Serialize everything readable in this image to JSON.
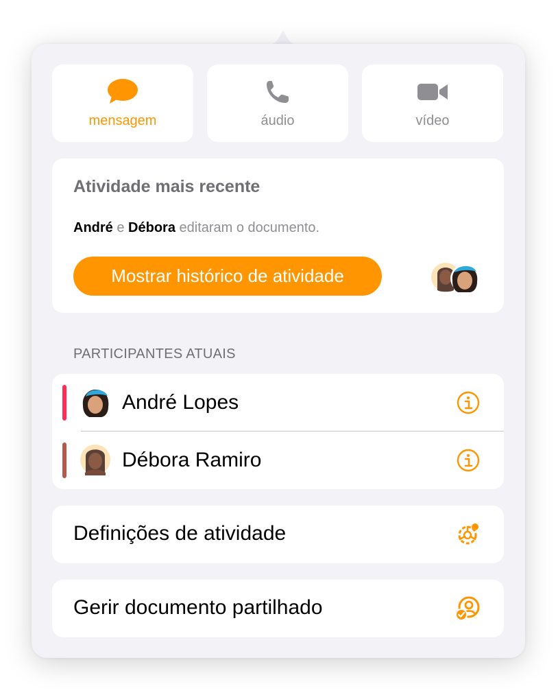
{
  "contact_buttons": [
    {
      "label": "mensagem",
      "icon": "message-bubble-icon",
      "active": true
    },
    {
      "label": "áudio",
      "icon": "phone-icon",
      "active": false
    },
    {
      "label": "vídeo",
      "icon": "video-camera-icon",
      "active": false
    }
  ],
  "activity": {
    "heading": "Atividade mais recente",
    "summary_name1": "André",
    "summary_and": " e ",
    "summary_name2": "Débora",
    "summary_rest": " editaram o documento.",
    "button_label": "Mostrar histórico de atividade"
  },
  "participants": {
    "header": "PARTICIPANTES ATUAIS",
    "items": [
      {
        "name": "André Lopes",
        "bar_color": "#ff2d55"
      },
      {
        "name": "Débora Ramiro",
        "bar_color": "#b5594b"
      }
    ]
  },
  "menu": {
    "activity_settings": "Definições de atividade",
    "manage_shared": "Gerir documento partilhado"
  },
  "colors": {
    "accent": "#ff9500",
    "panel": "#f2f2f7",
    "secondary_text": "#8e8e93"
  }
}
